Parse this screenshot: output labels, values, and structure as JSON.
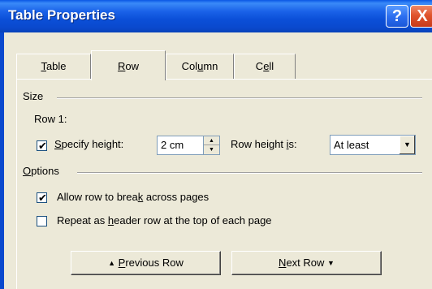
{
  "window": {
    "title": "Table Properties",
    "help_glyph": "?",
    "close_glyph": "X"
  },
  "tabs": [
    {
      "label": "Table",
      "accel": "T",
      "rest": "able"
    },
    {
      "label": "Row",
      "accel": "R",
      "rest": "ow"
    },
    {
      "label": "Column",
      "pre": "Col",
      "accel": "u",
      "rest": "mn"
    },
    {
      "label": "Cell",
      "pre": "C",
      "accel": "e",
      "rest": "ll"
    }
  ],
  "active_tab": "Row",
  "size_group": {
    "label": "Size",
    "row_label": "Row 1:",
    "specify_height": {
      "pre": "",
      "accel": "S",
      "rest": "pecify height:",
      "checked": true
    },
    "height_value": "2 cm",
    "row_height_is": {
      "pre": "Row height ",
      "accel": "i",
      "rest": "s:"
    },
    "row_height_mode": "At least"
  },
  "options_group": {
    "label_accel": "O",
    "label_rest": "ptions",
    "allow_break": {
      "pre": "Allow row to brea",
      "accel": "k",
      "rest": " across pages",
      "checked": true
    },
    "repeat_header": {
      "pre": "Repeat as ",
      "accel": "h",
      "rest": "eader row at the top of each page",
      "checked": false
    }
  },
  "buttons": {
    "previous": {
      "accel": "P",
      "rest": "revious Row",
      "icon": "up-arrow-icon"
    },
    "next": {
      "accel": "N",
      "rest": "ext Row",
      "icon": "down-arrow-icon"
    }
  }
}
